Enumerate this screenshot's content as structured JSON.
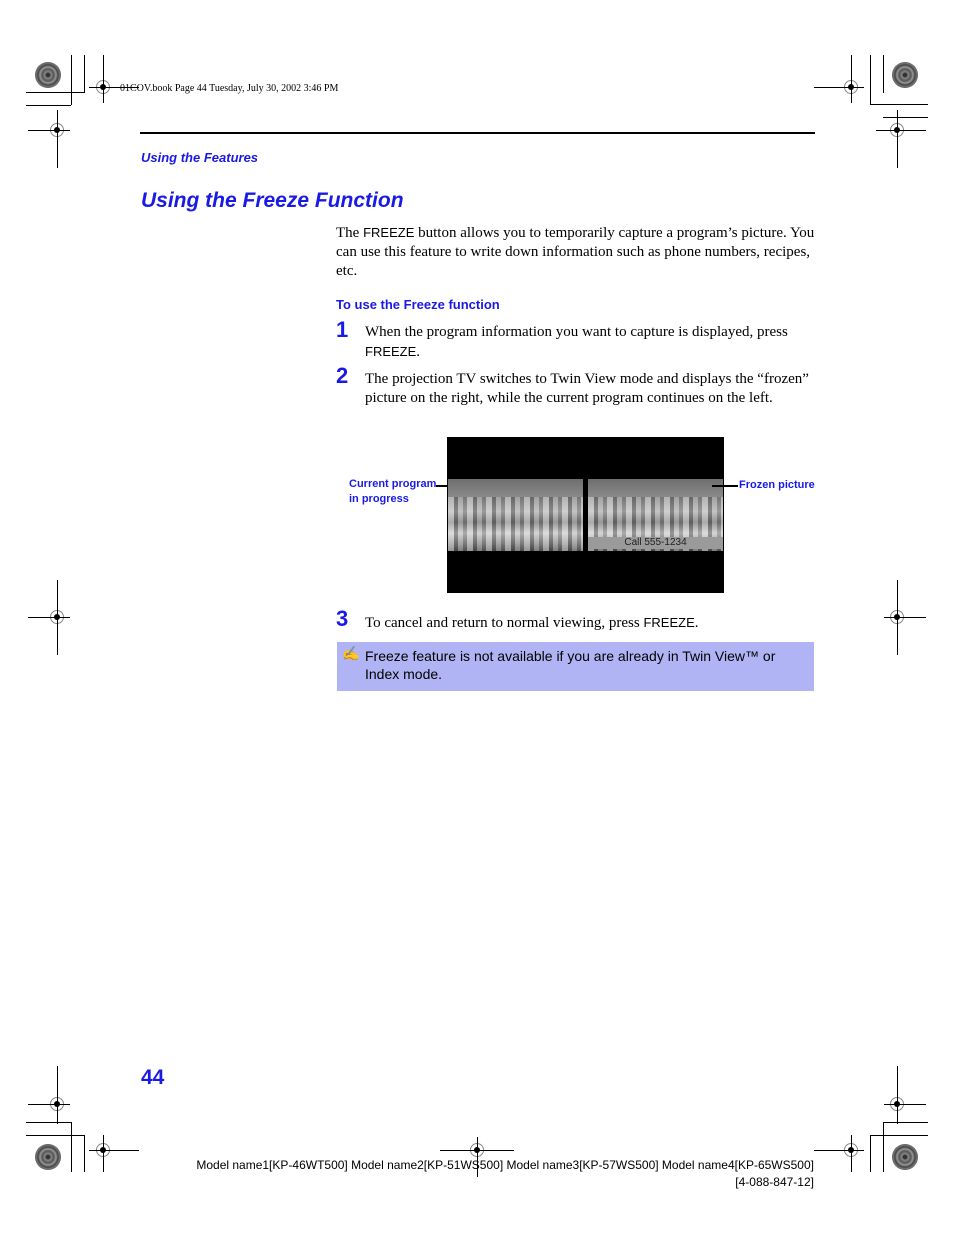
{
  "header": {
    "book_info": "01COV.book  Page 44  Tuesday, July 30, 2002  3:46 PM",
    "section": "Using the Features"
  },
  "title": "Using the Freeze Function",
  "intro": {
    "prefix": "The ",
    "button": "FREEZE",
    "suffix": " button allows you to temporarily capture a program’s picture. You can use this feature to write down information such as phone numbers, recipes, etc."
  },
  "procedure": {
    "heading": "To use the Freeze function",
    "steps": [
      {
        "num": "1",
        "text": "When the program information you want to capture is displayed, press ",
        "button": "FREEZE",
        "end": "."
      },
      {
        "num": "2",
        "text": "The projection TV switches to Twin View mode and displays the “frozen” picture on the right, while the current program continues on the left."
      },
      {
        "num": "3",
        "text": "To cancel and return to normal viewing, press ",
        "button": "FREEZE",
        "end": "."
      }
    ]
  },
  "figure": {
    "left_label_line1": "Current program",
    "left_label_line2": "in progress",
    "right_label": "Frozen picture",
    "caption_bar": "Call 555-1234"
  },
  "note": {
    "icon": "pencil-note-icon",
    "text": "Freeze feature is not available if you are already in Twin View™ or Index mode."
  },
  "page_number": "44",
  "footer": {
    "models": "Model name1[KP-46WT500] Model name2[KP-51WS500] Model name3[KP-57WS500] Model name4[KP-65WS500]",
    "code": "[4-088-847-12]"
  }
}
